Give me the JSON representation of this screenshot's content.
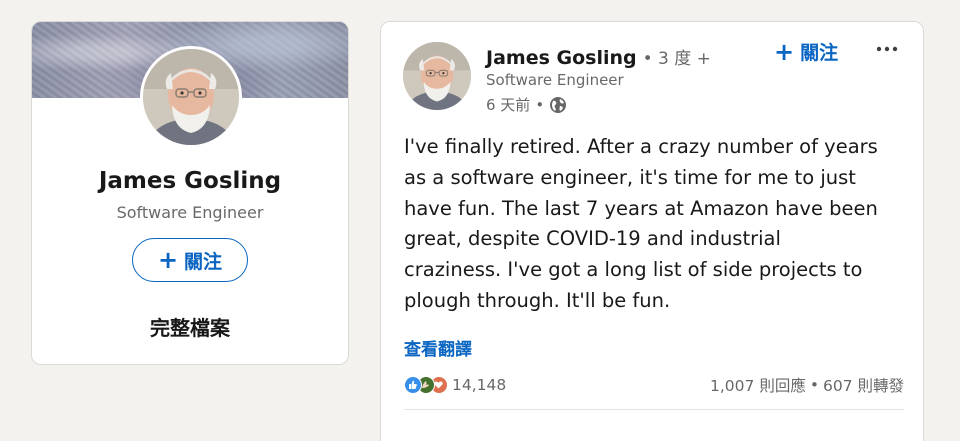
{
  "profile": {
    "name": "James Gosling",
    "headline": "Software Engineer",
    "follow_label": "關注",
    "full_profile_label": "完整檔案",
    "follow_icon": "plus-icon"
  },
  "post": {
    "author_name": "James Gosling",
    "degree": "• 3 度 +",
    "author_headline": "Software Engineer",
    "time": "6 天前",
    "dot": "•",
    "visibility_icon": "globe-icon",
    "follow_label": "關注",
    "more_label": "•••",
    "text_lines": [
      "I've finally retired. After a crazy number of years",
      "as a software engineer, it's time for me to just",
      "have fun. The last 7 years at Amazon have been",
      "great, despite COVID-19 and industrial",
      "craziness. I've got a long list of side projects to",
      "plough through. It'll be fun."
    ],
    "see_translation": "查看翻譯",
    "reaction_count": "14,148",
    "reaction_icons": [
      "like-icon",
      "celebrate-icon",
      "love-icon"
    ],
    "comments": "1,007 則回應",
    "separator": "•",
    "reposts": "607 則轉發"
  },
  "colors": {
    "accent": "#0a66c2",
    "background": "#f3f2ef",
    "card": "#ffffff",
    "like": "#378fe9",
    "celebrate": "#44712e",
    "love": "#df704d"
  }
}
